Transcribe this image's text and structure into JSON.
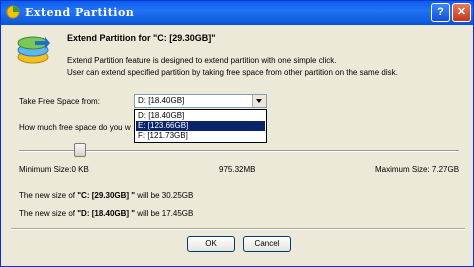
{
  "window": {
    "title": "Extend Partition",
    "help_glyph": "?",
    "close_glyph": "✕"
  },
  "header": {
    "title": "Extend Partition for \"C: [29.30GB]\"",
    "line1": "Extend Partition feature is designed to extend partition with one simple click.",
    "line2": "User can extend specified partition by taking free space from other partition on the same disk."
  },
  "take_from": {
    "label": "Take Free Space from:",
    "selected": "D:  [18.40GB]",
    "options": [
      "D:  [18.40GB]",
      "E:  [123.66GB]",
      "F:  [121.73GB]"
    ],
    "selected_option_index": 1
  },
  "how_much": {
    "label": "How much free space do you w"
  },
  "slider": {
    "min_label": "Minimum Size:0 KB",
    "current_label": "975.32MB",
    "max_label": "Maximum Size: 7.27GB",
    "position_fraction": 0.13
  },
  "results": {
    "c_prefix": "The new size of ",
    "c_name": "\"C: [29.30GB] \"",
    "c_suffix": " will be 30.25GB",
    "d_prefix": "The new size of ",
    "d_name": "\"D: [18.40GB] \"",
    "d_suffix": " will be 17.45GB"
  },
  "buttons": {
    "ok": "OK",
    "cancel": "Cancel"
  },
  "icons": {
    "app": "partition-app-icon",
    "header": "extend-partition-icon",
    "combo": "dropdown-arrow-icon"
  }
}
